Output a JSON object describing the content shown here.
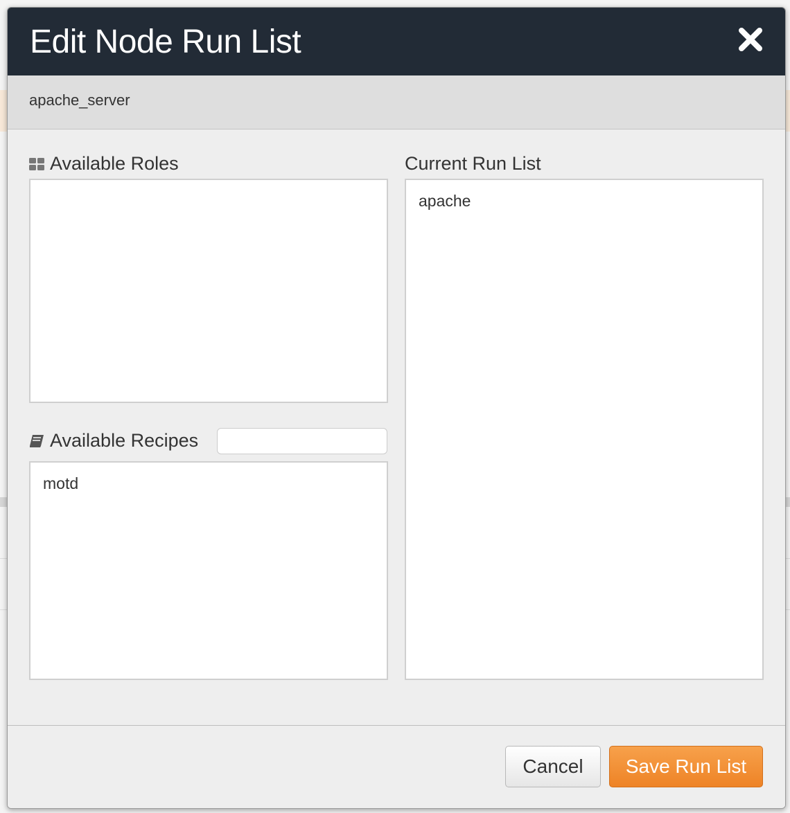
{
  "modal": {
    "title": "Edit Node Run List",
    "node_name": "apache_server"
  },
  "available_roles": {
    "label": "Available Roles",
    "icon": "roles-grid-icon",
    "items": []
  },
  "available_recipes": {
    "label": "Available Recipes",
    "icon": "book-icon",
    "filter_value": "",
    "filter_placeholder": "",
    "items": [
      "motd"
    ]
  },
  "current_run_list": {
    "label": "Current Run List",
    "items": [
      "apache"
    ]
  },
  "footer": {
    "cancel_label": "Cancel",
    "save_label": "Save Run List"
  },
  "colors": {
    "header_bg": "#222b36",
    "accent_orange": "#ee8326"
  }
}
